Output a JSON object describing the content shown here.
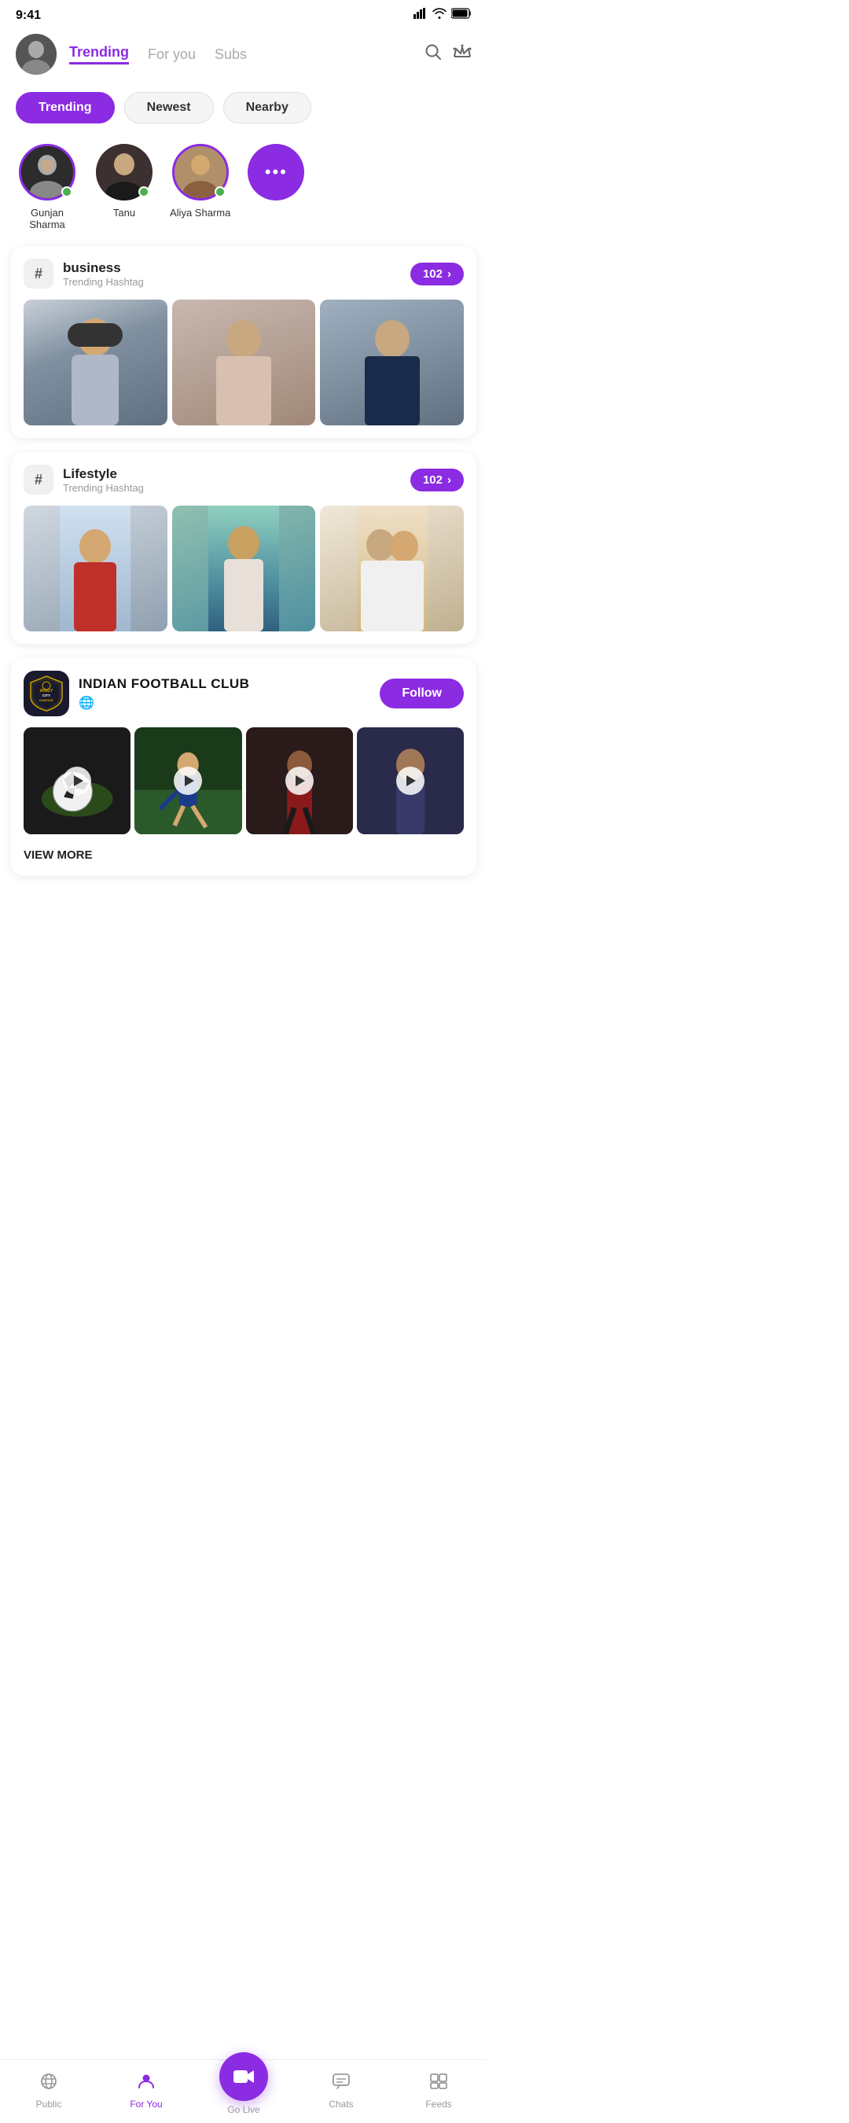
{
  "statusBar": {
    "time": "9:41"
  },
  "header": {
    "tabs": [
      {
        "id": "trending",
        "label": "Trending",
        "active": true
      },
      {
        "id": "foryou",
        "label": "For you",
        "active": false
      },
      {
        "id": "subs",
        "label": "Subs",
        "active": false
      }
    ],
    "searchIcon": "🔍",
    "crownIcon": "👑"
  },
  "filterPills": [
    {
      "id": "trending",
      "label": "Trending",
      "active": true
    },
    {
      "id": "newest",
      "label": "Newest",
      "active": false
    },
    {
      "id": "nearby",
      "label": "Nearby",
      "active": false
    }
  ],
  "stories": [
    {
      "id": "gunjan",
      "name": "Gunjan Sharma",
      "online": true,
      "hasRing": true
    },
    {
      "id": "tanu",
      "name": "Tanu",
      "online": true,
      "hasRing": false
    },
    {
      "id": "aliya",
      "name": "Aliya Sharma",
      "online": true,
      "hasRing": true
    },
    {
      "id": "more",
      "name": "",
      "isMore": true
    }
  ],
  "hashtagCards": [
    {
      "id": "business",
      "tag": "business",
      "sub": "Trending Hashtag",
      "count": "102",
      "images": [
        "person_winter",
        "person_hijab_pink",
        "person_hijab_black"
      ]
    },
    {
      "id": "lifestyle",
      "tag": "Lifestyle",
      "sub": "Trending Hashtag",
      "count": "102",
      "images": [
        "man_sunglasses",
        "man_beach",
        "group_women"
      ]
    }
  ],
  "clubCard": {
    "name": "INDIAN FOOTBALL CLUB",
    "globeIcon": "🌐",
    "followLabel": "Follow",
    "viewMoreLabel": "VIEW MORE",
    "videos": [
      "video1",
      "video2",
      "video3",
      "video4"
    ]
  },
  "bottomNav": [
    {
      "id": "public",
      "icon": "📡",
      "label": "Public",
      "active": false
    },
    {
      "id": "foryou",
      "icon": "👤",
      "label": "For You",
      "active": true
    },
    {
      "id": "golive",
      "icon": "🎥",
      "label": "Go Live",
      "active": false,
      "isCenter": true
    },
    {
      "id": "chats",
      "icon": "💬",
      "label": "Chats",
      "active": false
    },
    {
      "id": "feeds",
      "icon": "📋",
      "label": "Feeds",
      "active": false
    }
  ]
}
